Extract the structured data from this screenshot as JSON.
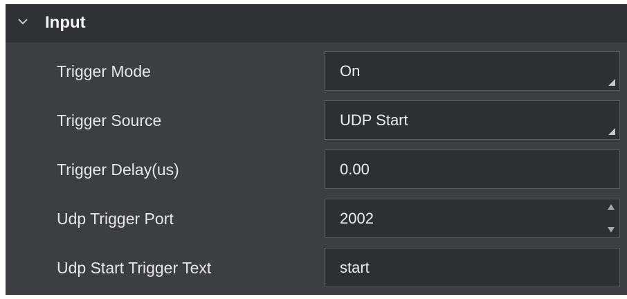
{
  "section": {
    "title": "Input",
    "collapse_icon": "chevron-down-icon"
  },
  "rows": [
    {
      "label": "Trigger Mode",
      "value": "On",
      "control": "dropdown"
    },
    {
      "label": "Trigger Source",
      "value": "UDP Start",
      "control": "dropdown"
    },
    {
      "label": "Trigger Delay(us)",
      "value": "0.00",
      "control": "text"
    },
    {
      "label": "Udp Trigger Port",
      "value": "2002",
      "control": "spinbox"
    },
    {
      "label": "Udp Start Trigger Text",
      "value": "start",
      "control": "text"
    }
  ],
  "colors": {
    "panel_bg": "#3d3e42",
    "header_bg": "#303135",
    "field_bg": "#2e2f32",
    "field_border": "#5b5c61",
    "text": "#e6e6e6"
  }
}
